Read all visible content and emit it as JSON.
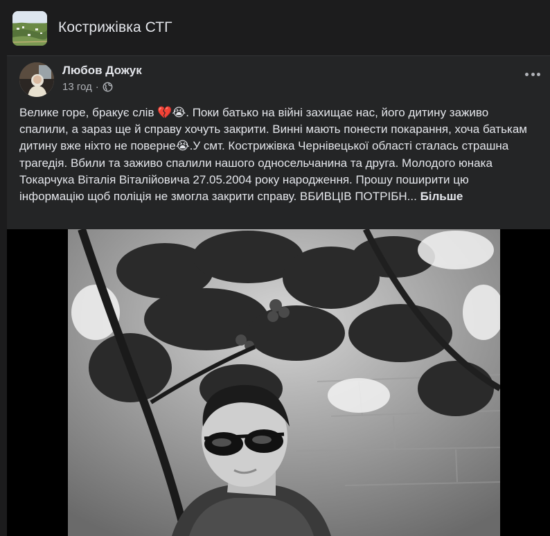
{
  "group": {
    "name": "Кострижівка СТГ",
    "thumbnail_icon": "group-landscape-thumbnail"
  },
  "post": {
    "author": "Любов Дожук",
    "time": "13 год",
    "separator": "·",
    "audience_icon": "globe-icon",
    "text": "Велике горе, бракує слів 💔😭. Поки батько на війні захищає нас, його дитину заживо спалили, а зараз ще й справу хочуть закрити.  Винні мають понести покарання, хоча батькам дитину вже ніхто не поверне😭.У смт.  Кострижівка Чернівецької області сталась страшна трагедія. Вбили та заживо спалили нашого односельчанина та друга. Молодого юнака Токарчука Віталія Віталійовича 27.05.2004 року народження. Прошу поширити цю інформацію щоб поліція не змогла закрити справу. ВБИВЦІВ ПОТРІБН...",
    "more_label": "Більше",
    "options_icon": "more-options-icon"
  },
  "media": {
    "image_icon": "post-photo",
    "colors": {
      "background": "#000000",
      "page": "#1c1c1d",
      "card": "#242526"
    }
  }
}
